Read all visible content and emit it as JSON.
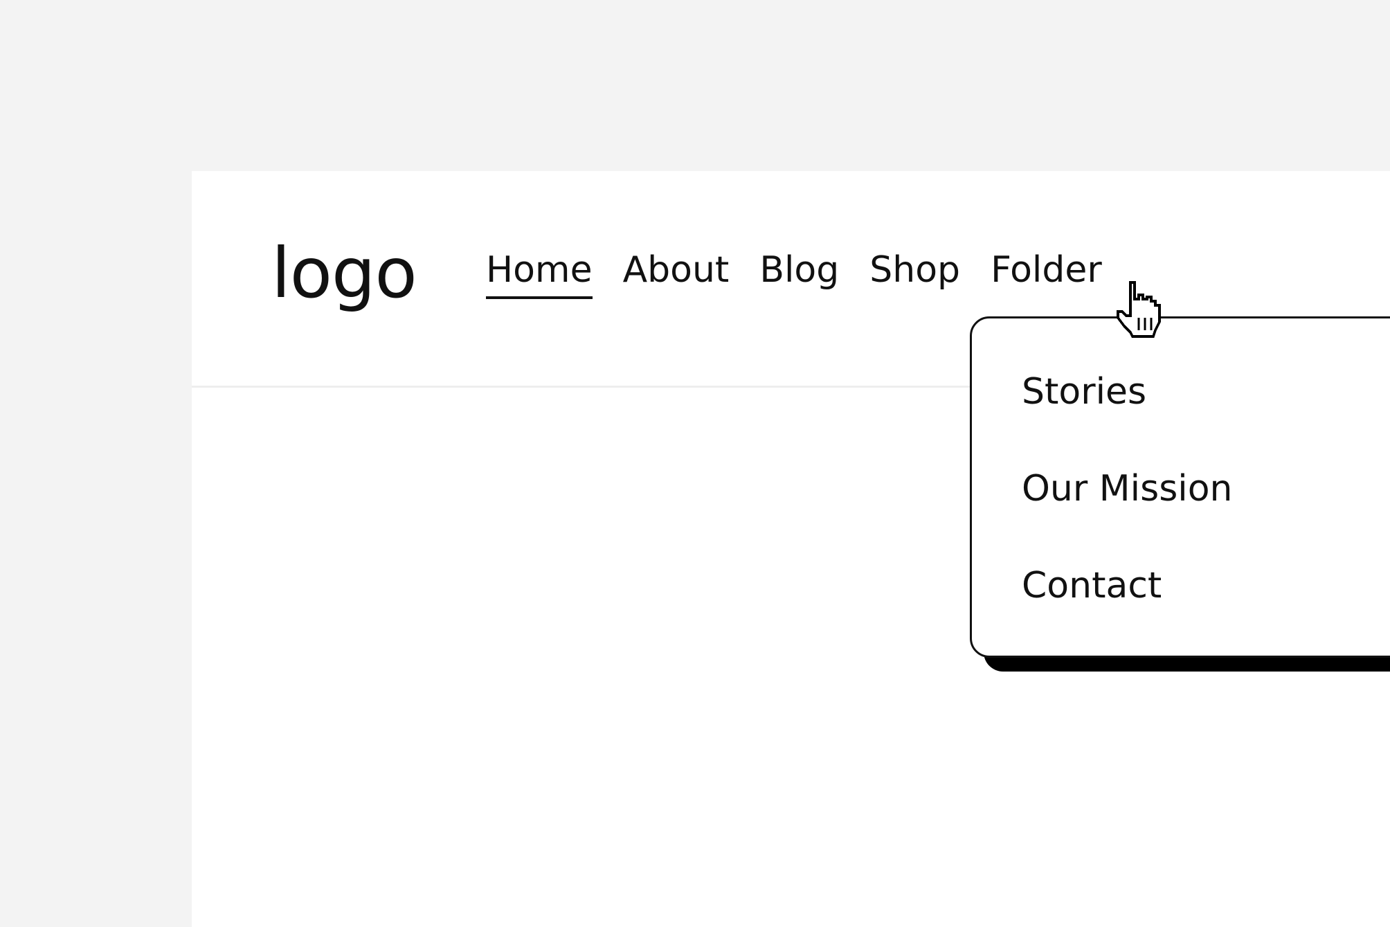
{
  "header": {
    "logo": "logo"
  },
  "nav": {
    "items": [
      {
        "label": "Home",
        "active": true
      },
      {
        "label": "About",
        "active": false
      },
      {
        "label": "Blog",
        "active": false
      },
      {
        "label": "Shop",
        "active": false
      },
      {
        "label": "Folder",
        "active": false
      }
    ]
  },
  "folder_dropdown": {
    "items": [
      {
        "label": "Stories"
      },
      {
        "label": "Our Mission"
      },
      {
        "label": "Contact"
      }
    ]
  },
  "cursor": {
    "icon": "hand-pointer-icon"
  },
  "colors": {
    "background": "#f3f3f3",
    "page": "#ffffff",
    "text": "#111111",
    "dropdown_shadow": "#000000"
  }
}
